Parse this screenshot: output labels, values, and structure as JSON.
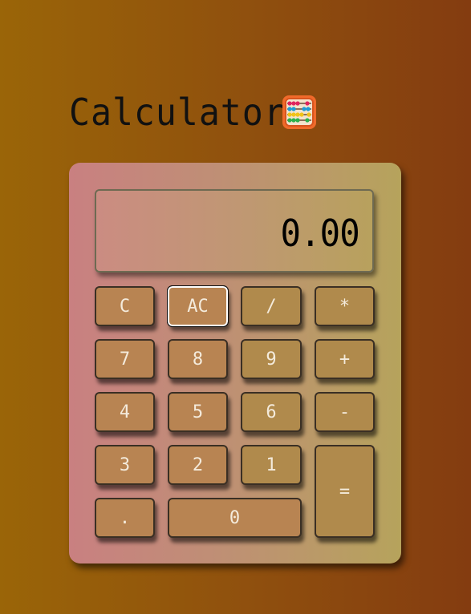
{
  "app": {
    "title": "Calculator",
    "title_icon": "abacus-icon"
  },
  "display": {
    "value": "0.00"
  },
  "keys": {
    "clear": "C",
    "all_clear": "AC",
    "divide": "/",
    "multiply": "*",
    "seven": "7",
    "eight": "8",
    "nine": "9",
    "plus": "+",
    "four": "4",
    "five": "5",
    "six": "6",
    "minus": "-",
    "three": "3",
    "two": "2",
    "one": "1",
    "equals": "=",
    "decimal": ".",
    "zero": "0"
  },
  "colors": {
    "background_start": "#9a6508",
    "background_end": "#843c10",
    "body_start": "#c98081",
    "body_end": "#b6a35c",
    "key_fill": "#b88452",
    "operator_fill": "#b08a4c",
    "key_text": "#f4ebdc"
  },
  "focused_key": "AC"
}
